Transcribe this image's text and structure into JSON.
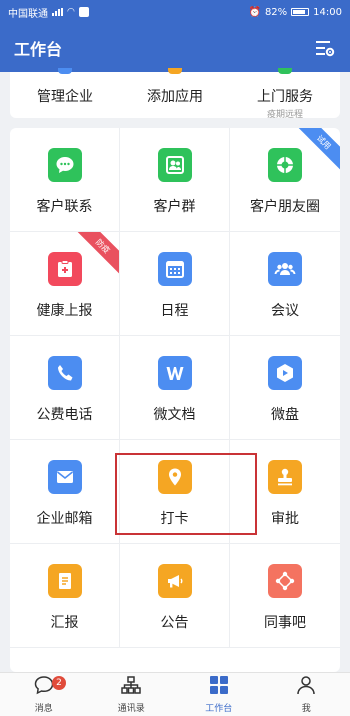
{
  "status_bar": {
    "carrier": "中国联通",
    "battery": "82%",
    "time": "14:00"
  },
  "header": {
    "title": "工作台"
  },
  "top_row": [
    {
      "label": "管理企业",
      "sub": ""
    },
    {
      "label": "添加应用",
      "sub": ""
    },
    {
      "label": "上门服务",
      "sub": "疫期远程"
    }
  ],
  "grid": [
    {
      "label": "客户联系",
      "icon": "chat-icon",
      "color": "#2fc25b"
    },
    {
      "label": "客户群",
      "icon": "group-icon",
      "color": "#2fc25b"
    },
    {
      "label": "客户朋友圈",
      "icon": "moments-icon",
      "color": "#2fc25b",
      "ribbon": "试用"
    },
    {
      "label": "健康上报",
      "icon": "health-icon",
      "color": "#f2495c",
      "ribbon": "防疫"
    },
    {
      "label": "日程",
      "icon": "calendar-icon",
      "color": "#4c8df1"
    },
    {
      "label": "会议",
      "icon": "meeting-icon",
      "color": "#4c8df1"
    },
    {
      "label": "公费电话",
      "icon": "phone-icon",
      "color": "#4c8df1"
    },
    {
      "label": "微文档",
      "icon": "document-icon",
      "color": "#4c8df1"
    },
    {
      "label": "微盘",
      "icon": "drive-icon",
      "color": "#4c8df1"
    },
    {
      "label": "企业邮箱",
      "icon": "mail-icon",
      "color": "#4c8df1"
    },
    {
      "label": "打卡",
      "icon": "location-icon",
      "color": "#f5a623"
    },
    {
      "label": "审批",
      "icon": "stamp-icon",
      "color": "#f5a623"
    },
    {
      "label": "汇报",
      "icon": "report-icon",
      "color": "#f5a623"
    },
    {
      "label": "公告",
      "icon": "megaphone-icon",
      "color": "#f5a623"
    },
    {
      "label": "同事吧",
      "icon": "share-icon",
      "color": "#f47360"
    }
  ],
  "bottom_nav": [
    {
      "label": "消息",
      "badge": "2"
    },
    {
      "label": "通讯录"
    },
    {
      "label": "工作台"
    },
    {
      "label": "我"
    }
  ],
  "colors": {
    "primary": "#3b6bc9",
    "highlight": "#c93336",
    "ribbon_trial": "#4c8df1",
    "ribbon_epidemic": "#e9515f"
  }
}
